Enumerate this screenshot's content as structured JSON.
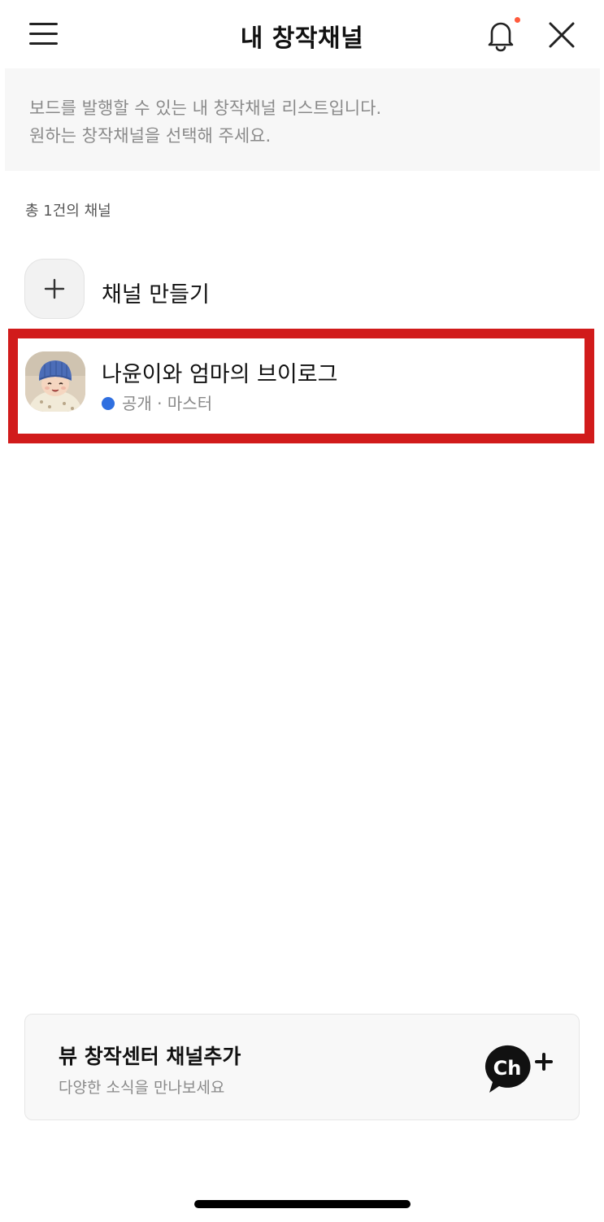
{
  "header": {
    "title": "내 창작채널",
    "has_unread_notification": true,
    "notification_dot_color": "#ff5a3c"
  },
  "notice": {
    "line1": "보드를 발행할 수 있는 내 창작채널 리스트입니다.",
    "line2": "원하는 창작채널을 선택해 주세요."
  },
  "channel_count_text": "총 1건의 채널",
  "create_channel": {
    "label": "채널 만들기",
    "icon": "plus-icon"
  },
  "channels": [
    {
      "name": "나윤이와 엄마의 브이로그",
      "visibility": "공개",
      "separator": " · ",
      "role": "마스터",
      "status_color": "#2f6fe0",
      "highlight_color": "#d11b1b"
    }
  ],
  "add_channel_card": {
    "title": "뷰 창작센터 채널추가",
    "subtitle": "다양한 소식을 만나보세요",
    "icon": "channel-add-icon",
    "logo_text": "Ch"
  }
}
